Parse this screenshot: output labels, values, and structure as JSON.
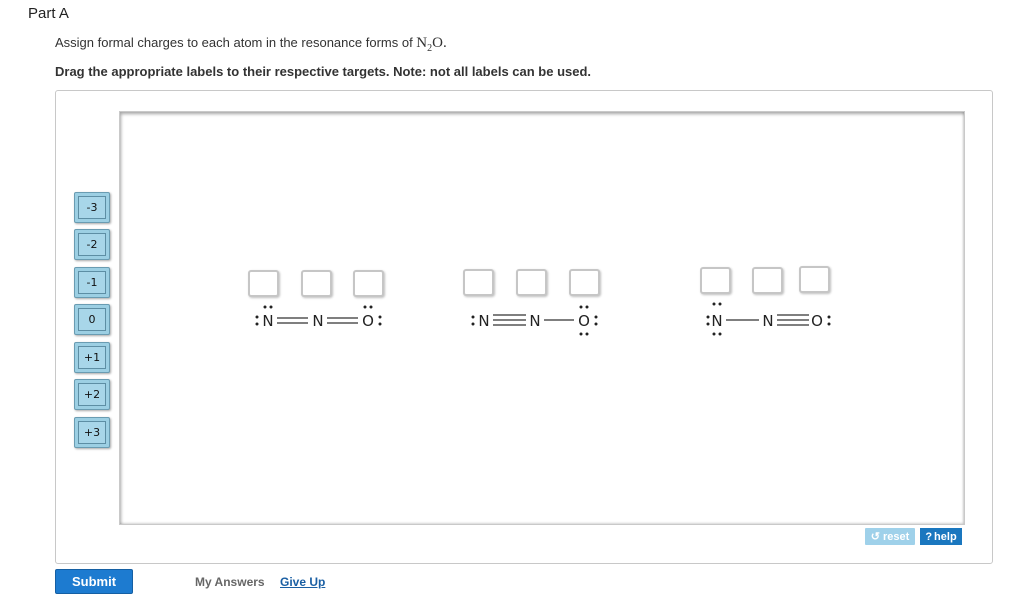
{
  "part": {
    "title": "Part A"
  },
  "question": {
    "prefix": "Assign formal charges to each atom in the resonance forms of ",
    "formula_main": "N",
    "formula_sub": "2",
    "formula_tail": "O."
  },
  "instruction": "Drag the appropriate labels to their respective targets. Note: not all labels can be used.",
  "labels": [
    "-3",
    "-2",
    "-1",
    "0",
    "+1",
    "+2",
    "+3"
  ],
  "structures": [
    {
      "atoms": [
        "N",
        "N",
        "O"
      ],
      "bonds": [
        "double",
        "double"
      ]
    },
    {
      "atoms": [
        "N",
        "N",
        "O"
      ],
      "bonds": [
        "triple",
        "single"
      ]
    },
    {
      "atoms": [
        "N",
        "N",
        "O"
      ],
      "bonds": [
        "single",
        "triple"
      ]
    }
  ],
  "buttons": {
    "reset": "reset",
    "help": "help",
    "submit": "Submit",
    "my_answers": "My Answers",
    "give_up": "Give Up"
  },
  "colors": {
    "label_fill": "#9ccfe3",
    "submit_blue": "#1d7bd0",
    "help_blue": "#1a77bf",
    "reset_blue": "#9fd1ea",
    "link_blue": "#1a5fa3"
  }
}
